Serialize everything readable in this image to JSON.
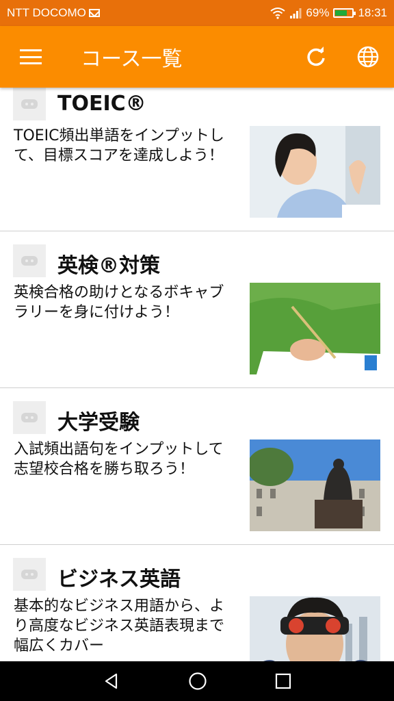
{
  "status_bar": {
    "carrier": "NTT DOCOMO",
    "battery": "69%",
    "time": "18:31"
  },
  "app_bar": {
    "title": "コース一覧",
    "icons": [
      "menu-icon",
      "refresh-icon",
      "globe-icon"
    ]
  },
  "courses": [
    {
      "title": "TOEIC®",
      "description": "TOEIC頻出単語をインプットして、目標スコアを達成しよう！",
      "thumbnail": "woman-celebrating-photo"
    },
    {
      "title": "英検®対策",
      "description": "英検合格の助けとなるボキャブラリーを身に付けよう！",
      "thumbnail": "student-writing-photo"
    },
    {
      "title": "大学受験",
      "description": "入試頻出語句をインプットして志望校合格を勝ち取ろう！",
      "thumbnail": "statue-building-photo"
    },
    {
      "title": "ビジネス英語",
      "description": "基本的なビジネス用語から、より高度なビジネス英語表現まで幅広くカバー",
      "thumbnail": "man-binoculars-photo"
    }
  ],
  "nav_bar": {
    "icons": [
      "back-icon",
      "home-icon",
      "recents-icon"
    ]
  },
  "colors": {
    "app_bar": "#fb8c00",
    "status_bar": "#e8700a",
    "divider": "#cfcfcf"
  }
}
